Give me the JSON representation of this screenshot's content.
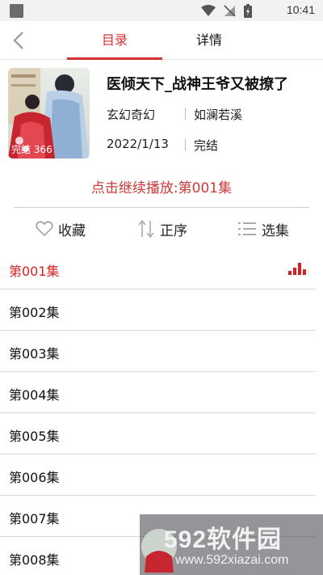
{
  "statusbar": {
    "time": "10:41"
  },
  "header": {
    "tabs": [
      {
        "label": "目录"
      },
      {
        "label": "详情"
      }
    ]
  },
  "book": {
    "cover_badge": "完结 366",
    "title": "医倾天下_战神王爷又被撩了",
    "genre": "玄幻奇幻",
    "author": "如澜若溪",
    "date": "2022/1/13",
    "status": "完结"
  },
  "continue_label": "点击继续播放:第001集",
  "actions": {
    "favorite": "收藏",
    "order": "正序",
    "select": "选集"
  },
  "episodes": [
    "第001集",
    "第002集",
    "第003集",
    "第004集",
    "第005集",
    "第006集",
    "第007集",
    "第008集"
  ],
  "watermark": {
    "brand": "592软件园",
    "url": "www.592xiazai.com"
  },
  "colors": {
    "accent": "#d62f2f"
  }
}
